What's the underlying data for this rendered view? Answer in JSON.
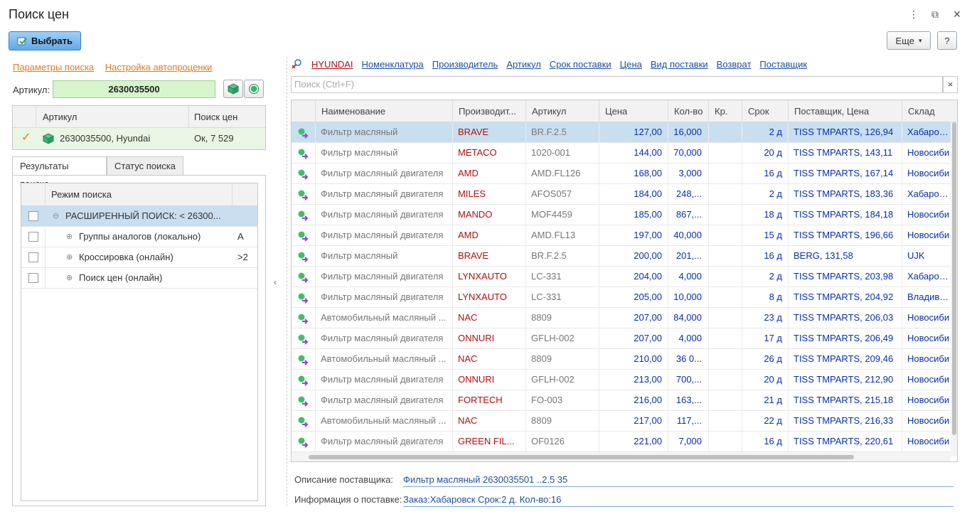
{
  "window": {
    "title": "Поиск цен",
    "menu_icon": "⋮",
    "restore_icon": "⧉",
    "close_icon": "✕"
  },
  "toolbar": {
    "select_label": "Выбрать",
    "more_label": "Еще",
    "help_label": "?"
  },
  "left": {
    "links": [
      "Параметры поиска",
      "Настройка автопроценки"
    ],
    "article_label": "Артикул:",
    "article_value": "2630035500",
    "query_grid": {
      "columns": [
        "Артикул",
        "Поиск цен"
      ],
      "rows": [
        {
          "check": "✓",
          "article": "2630035500, Hyundai",
          "status": "Ок, 7 529"
        }
      ]
    },
    "tabs": [
      "Результаты поиска",
      "Статус поиска"
    ],
    "mode_grid": {
      "column": "Режим поиска",
      "rows": [
        {
          "label": "РАСШИРЕННЫЙ ПОИСК: < 26300...",
          "value": "",
          "tree": "⊖",
          "selected": true
        },
        {
          "label": "Группы аналогов (локально)",
          "value": "А",
          "tree": "⊕",
          "selected": false
        },
        {
          "label": "Кроссировка (онлайн)",
          "value": ">2",
          "tree": "⊕",
          "selected": false
        },
        {
          "label": "Поиск цен (онлайн)",
          "value": "",
          "tree": "⊕",
          "selected": false
        }
      ]
    },
    "collapse_icon": "‹"
  },
  "right": {
    "nav_links": [
      "HYUNDAI",
      "Номенклатура",
      "Производитель",
      "Артикул",
      "Срок поставки",
      "Цена",
      "Вид поставки",
      "Возврат",
      "Поставщик"
    ],
    "search_placeholder": "Поиск (Ctrl+F)",
    "clear_icon": "×",
    "columns": [
      "Наименование",
      "Производит...",
      "Артикул",
      "Цена",
      "Кол-во",
      "Кр.",
      "Срок",
      "Поставщик, Цена",
      "Склад"
    ],
    "rows": [
      {
        "name": "Фильтр масляный",
        "mfr": "BRAVE",
        "art": "BR.F.2.5",
        "price": "127,00",
        "qty": "16,000",
        "kr": "",
        "term": "2 д",
        "supplier": "TISS TMPARTS, 126,94",
        "stock": "Хабаровск"
      },
      {
        "name": "Фильтр масляный",
        "mfr": "METACO",
        "art": "1020-001",
        "price": "144,00",
        "qty": "70,000",
        "kr": "",
        "term": "20 д",
        "supplier": "TISS TMPARTS, 143,11",
        "stock": "Новосиби"
      },
      {
        "name": "Фильтр масляный двигателя",
        "mfr": "AMD",
        "art": "AMD.FL126",
        "price": "168,00",
        "qty": "3,000",
        "kr": "",
        "term": "16 д",
        "supplier": "TISS TMPARTS, 167,14",
        "stock": "Новосиби"
      },
      {
        "name": "Фильтр масляный двигателя",
        "mfr": "MILES",
        "art": "AFOS057",
        "price": "184,00",
        "qty": "248,...",
        "kr": "",
        "term": "2 д",
        "supplier": "TISS TMPARTS, 183,36",
        "stock": "Хабаровск"
      },
      {
        "name": "Фильтр масляный двигателя",
        "mfr": "MANDO",
        "art": "MOF4459",
        "price": "185,00",
        "qty": "867,...",
        "kr": "",
        "term": "18 д",
        "supplier": "TISS TMPARTS, 184,18",
        "stock": "Новосиби"
      },
      {
        "name": "Фильтр масляный двигателя",
        "mfr": "AMD",
        "art": "AMD.FL13",
        "price": "197,00",
        "qty": "40,000",
        "kr": "",
        "term": "15 д",
        "supplier": "TISS TMPARTS, 196,66",
        "stock": "Новосиби"
      },
      {
        "name": "Фильтр масляный",
        "mfr": "BRAVE",
        "art": "BR.F.2.5",
        "price": "200,00",
        "qty": "201,...",
        "kr": "",
        "term": "16 д",
        "supplier": "BERG, 131,58",
        "stock": "UJK"
      },
      {
        "name": "Фильтр масляный двигателя",
        "mfr": "LYNXAUTO",
        "art": "LC-331",
        "price": "204,00",
        "qty": "4,000",
        "kr": "",
        "term": "2 д",
        "supplier": "TISS TMPARTS, 203,98",
        "stock": "Хабаровск"
      },
      {
        "name": "Фильтр масляный двигателя",
        "mfr": "LYNXAUTO",
        "art": "LC-331",
        "price": "205,00",
        "qty": "10,000",
        "kr": "",
        "term": "8 д",
        "supplier": "TISS TMPARTS, 204,92",
        "stock": "Владиво..."
      },
      {
        "name": "Автомобильный масляный ...",
        "mfr": "NAC",
        "art": "8809",
        "price": "207,00",
        "qty": "84,000",
        "kr": "",
        "term": "23 д",
        "supplier": "TISS TMPARTS, 206,03",
        "stock": "Новосиби"
      },
      {
        "name": "Фильтр масляный двигателя",
        "mfr": "ONNURI",
        "art": "GFLH-002",
        "price": "207,00",
        "qty": "4,000",
        "kr": "",
        "term": "17 д",
        "supplier": "TISS TMPARTS, 206,49",
        "stock": "Новосиби"
      },
      {
        "name": "Автомобильный масляный ...",
        "mfr": "NAC",
        "art": "8809",
        "price": "210,00",
        "qty": "36 0...",
        "kr": "",
        "term": "26 д",
        "supplier": "TISS TMPARTS, 209,46",
        "stock": "Новосиби"
      },
      {
        "name": "Фильтр масляный двигателя",
        "mfr": "ONNURI",
        "art": "GFLH-002",
        "price": "213,00",
        "qty": "700,...",
        "kr": "",
        "term": "20 д",
        "supplier": "TISS TMPARTS, 212,90",
        "stock": "Новосиби"
      },
      {
        "name": "Фильтр масляный двигателя",
        "mfr": "FORTECH",
        "art": "FO-003",
        "price": "216,00",
        "qty": "163,...",
        "kr": "",
        "term": "21 д",
        "supplier": "TISS TMPARTS, 215,18",
        "stock": "Новосиби"
      },
      {
        "name": "Автомобильный масляный ...",
        "mfr": "NAC",
        "art": "8809",
        "price": "217,00",
        "qty": "117,...",
        "kr": "",
        "term": "22 д",
        "supplier": "TISS TMPARTS, 216,33",
        "stock": "Новосиби"
      },
      {
        "name": "Фильтр масляный двигателя",
        "mfr": "GREEN FIL...",
        "art": "OF0126",
        "price": "221,00",
        "qty": "7,000",
        "kr": "",
        "term": "16 д",
        "supplier": "TISS TMPARTS, 220,61",
        "stock": "Новосиби"
      }
    ],
    "supplier_description_label": "Описание поставщика:",
    "supplier_description_value": "Фильтр масляный 2630035501 ..2.5     35",
    "delivery_info_label": "Информация о поставке:",
    "delivery_info_value": "Заказ:Хабаровск Срок:2 д. Кол-во:16"
  },
  "colors": {
    "accent_blue": "#62a9e6",
    "link_orange": "#e07a1e",
    "manufacturer_red": "#b01010",
    "value_blue": "#0a2fa8",
    "selected_row": "#c9dff0",
    "article_field": "#d6f5cc"
  }
}
